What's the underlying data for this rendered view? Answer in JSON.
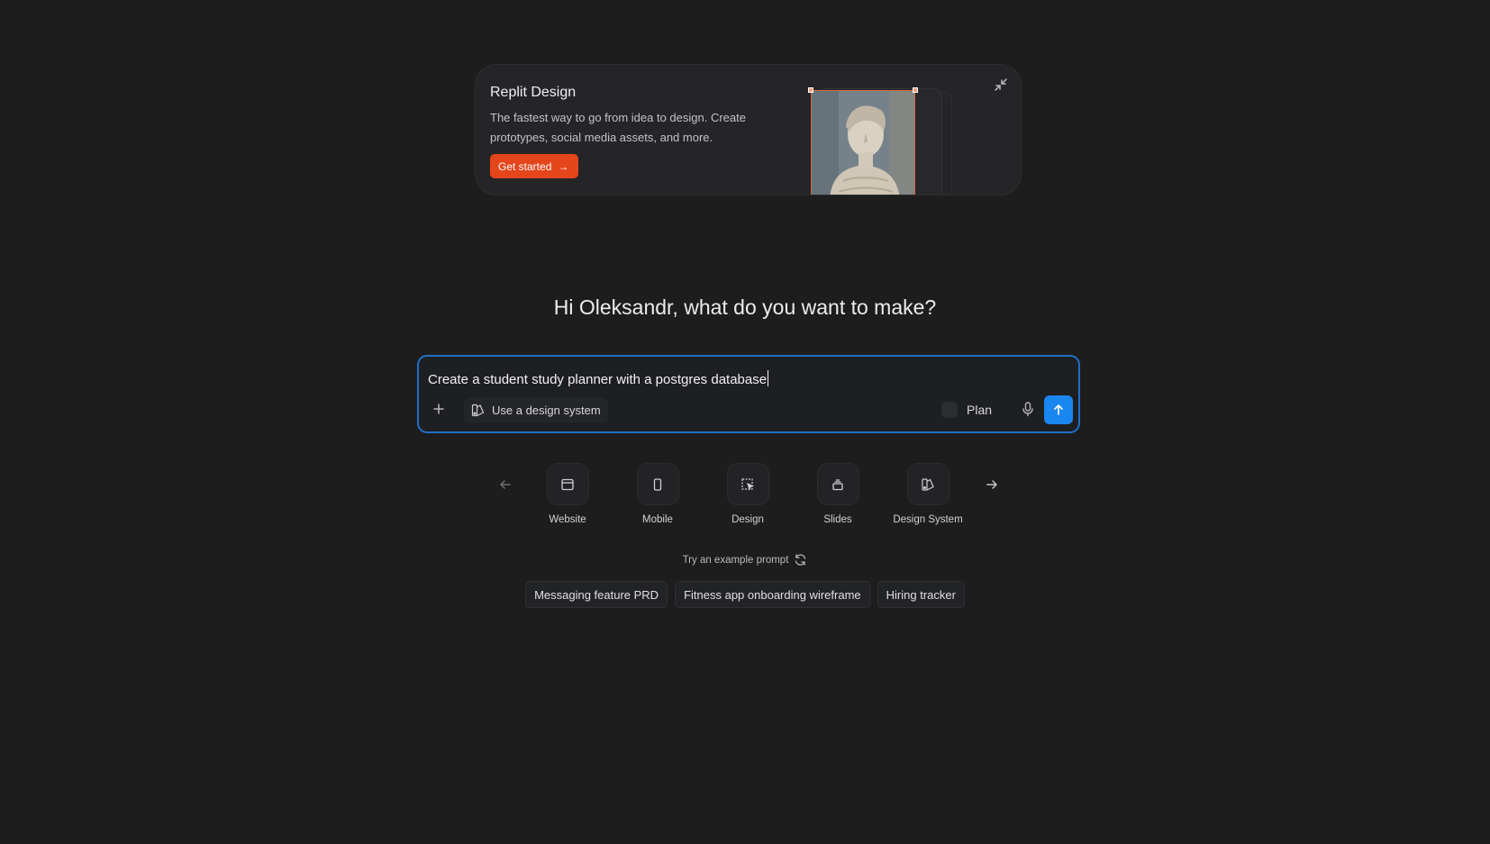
{
  "promo": {
    "title": "Replit Design",
    "description": "The fastest way to go from idea to design. Create prototypes, social media assets, and more.",
    "cta_label": "Get started",
    "accent_color": "#e5451b"
  },
  "greeting": "Hi Oleksandr, what do you want to make?",
  "prompt": {
    "value": "Create a student study planner with a postgres database",
    "design_system_label": "Use a design system",
    "plan_label": "Plan",
    "send_color": "#1a86f0",
    "border_color": "#1f6fc8"
  },
  "categories": [
    {
      "label": "Website",
      "icon": "browser-window-icon"
    },
    {
      "label": "Mobile",
      "icon": "phone-icon"
    },
    {
      "label": "Design",
      "icon": "design-select-icon"
    },
    {
      "label": "Slides",
      "icon": "slides-stack-icon"
    },
    {
      "label": "Design System",
      "icon": "design-system-icon"
    }
  ],
  "examples": {
    "hint": "Try an example prompt",
    "chips": [
      "Messaging feature PRD",
      "Fitness app onboarding wireframe",
      "Hiring tracker"
    ]
  }
}
